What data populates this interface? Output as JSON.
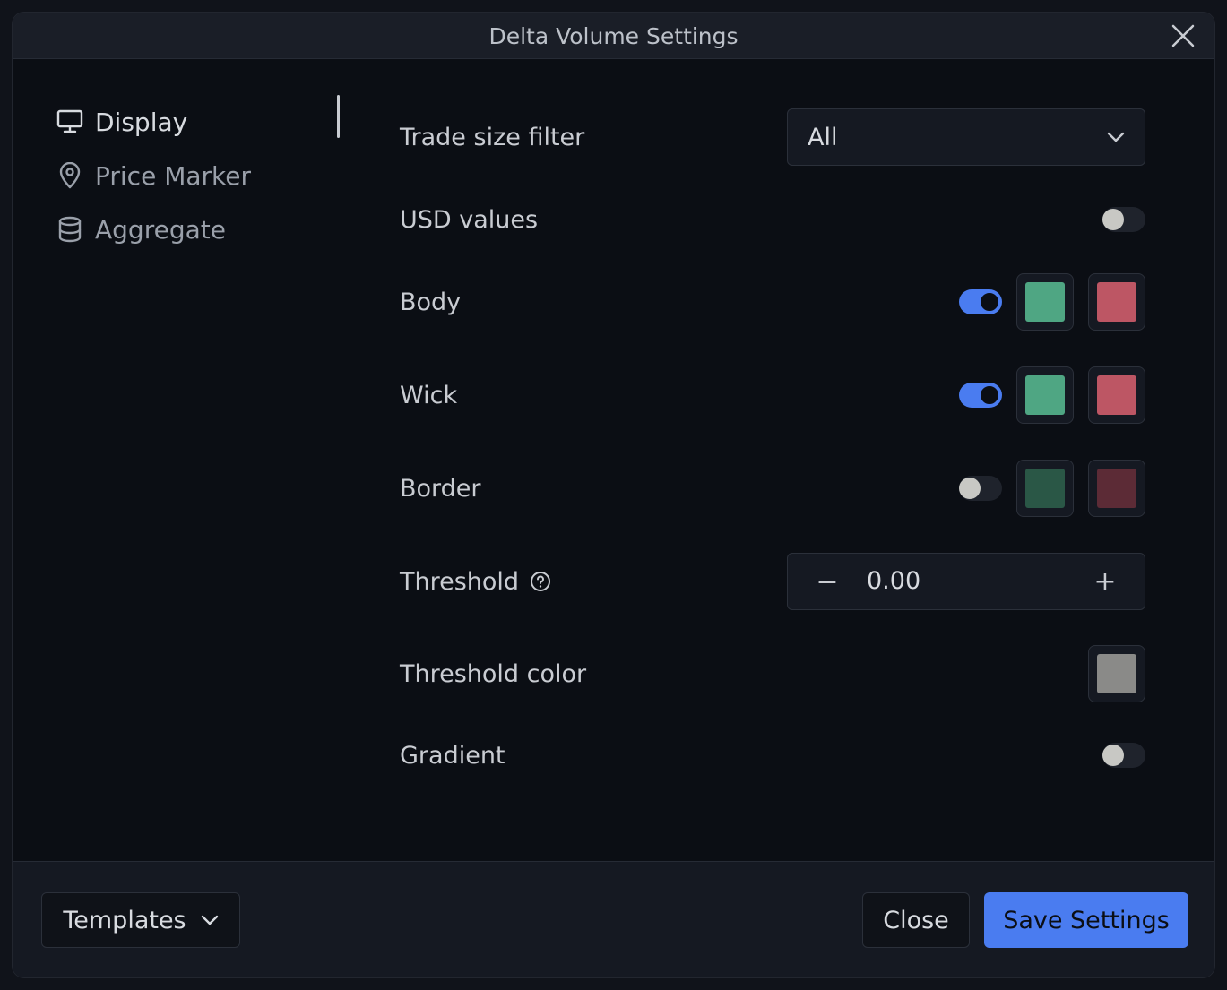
{
  "dialog": {
    "title": "Delta Volume Settings"
  },
  "sidebar": {
    "items": [
      {
        "label": "Display",
        "icon": "monitor-icon",
        "active": true
      },
      {
        "label": "Price Marker",
        "icon": "map-pin-icon",
        "active": false
      },
      {
        "label": "Aggregate",
        "icon": "database-icon",
        "active": false
      }
    ]
  },
  "settings": {
    "trade_size_filter": {
      "label": "Trade size filter",
      "value": "All"
    },
    "usd_values": {
      "label": "USD values",
      "enabled": false
    },
    "body": {
      "label": "Body",
      "enabled": true,
      "up_color": "#4fa683",
      "down_color": "#bd5664"
    },
    "wick": {
      "label": "Wick",
      "enabled": true,
      "up_color": "#4fa683",
      "down_color": "#bd5664"
    },
    "border": {
      "label": "Border",
      "enabled": false,
      "up_color": "#2a5746",
      "down_color": "#5c2b36"
    },
    "threshold": {
      "label": "Threshold",
      "value": "0.00",
      "minus": "−",
      "plus": "+"
    },
    "threshold_color": {
      "label": "Threshold color",
      "color": "#8a8a88"
    },
    "gradient": {
      "label": "Gradient",
      "enabled": false
    }
  },
  "footer": {
    "templates_label": "Templates",
    "close_label": "Close",
    "save_label": "Save Settings"
  },
  "colors": {
    "accent": "#4a7cf0",
    "background": "#0b0e14"
  }
}
